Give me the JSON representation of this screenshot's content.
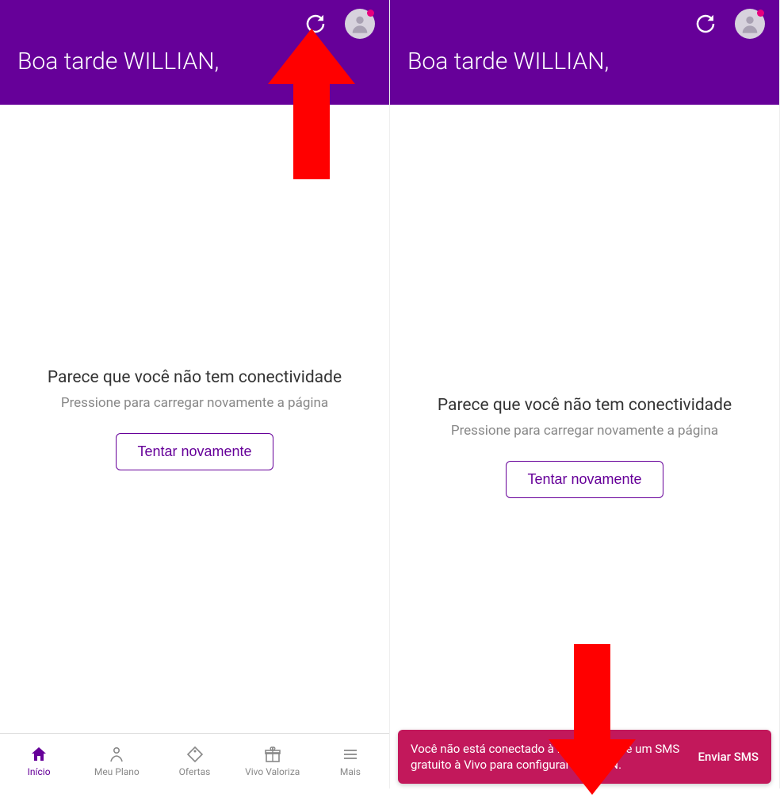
{
  "colors": {
    "brand": "#660099",
    "toast": "#c2185b",
    "annotation": "#ff0000"
  },
  "header": {
    "greeting": "Boa tarde WILLIAN,"
  },
  "error": {
    "title": "Parece que você não tem conectividade",
    "subtitle": "Pressione para carregar novamente a página",
    "retry_label": "Tentar novamente"
  },
  "nav": {
    "items": [
      {
        "label": "Início",
        "active": true,
        "icon": "home"
      },
      {
        "label": "Meu Plano",
        "active": false,
        "icon": "person"
      },
      {
        "label": "Ofertas",
        "active": false,
        "icon": "tag"
      },
      {
        "label": "Vivo Valoriza",
        "active": false,
        "icon": "gift"
      },
      {
        "label": "Mais",
        "active": false,
        "icon": "menu"
      }
    ]
  },
  "toast": {
    "message": "Você não está conectado à Internet. Envie um SMS gratuito à Vivo para configurar seu APN.",
    "action_label": "Enviar SMS"
  }
}
